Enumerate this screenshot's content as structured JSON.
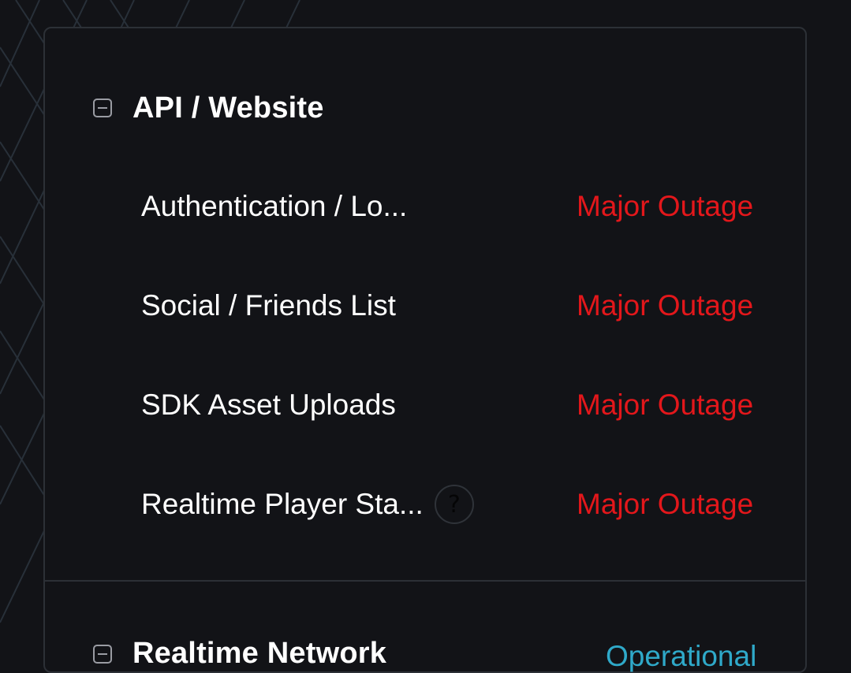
{
  "groups": [
    {
      "title": "API / Website",
      "components": [
        {
          "name": "Authentication / Lo...",
          "status": "Major Outage"
        },
        {
          "name": "Social / Friends List",
          "status": "Major Outage"
        },
        {
          "name": "SDK Asset Uploads",
          "status": "Major Outage"
        },
        {
          "name": "Realtime Player Sta...",
          "status": "Major Outage",
          "help_icon": "?"
        }
      ]
    },
    {
      "title": "Realtime Network",
      "status": "Operational"
    }
  ],
  "colors": {
    "background": "#121317",
    "card_border": "#2c3036",
    "major_outage": "#e3171b",
    "operational": "#2fa9c9",
    "text": "#ffffff"
  }
}
